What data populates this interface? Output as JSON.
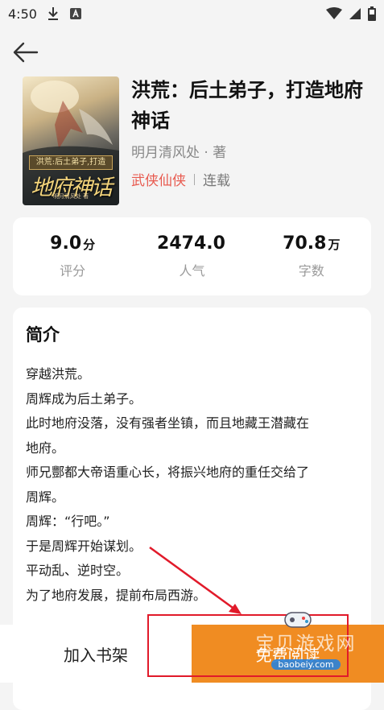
{
  "status_bar": {
    "time": "4:50",
    "left_icons": [
      "download-icon",
      "a-font-icon"
    ],
    "right_icons": [
      "wifi-icon",
      "signal-icon",
      "battery-icon"
    ]
  },
  "header": {
    "back_icon": "back-arrow-icon"
  },
  "book": {
    "title": "洪荒：后土弟子，打造地府神话",
    "author": "明月清风处 · 著",
    "genre": "武侠仙侠",
    "status": "连载",
    "cover": {
      "band_text": "洪荒:后土弟子,打造",
      "big_text": "地府神话",
      "author_text": "明月清风处 著"
    }
  },
  "stats": [
    {
      "value": "9.0",
      "unit": "分",
      "label": "评分"
    },
    {
      "value": "2474.0",
      "unit": "",
      "label": "人气"
    },
    {
      "value": "70.8",
      "unit": "万",
      "label": "字数"
    }
  ],
  "intro": {
    "title": "简介",
    "lines": [
      "穿越洪荒。",
      "周辉成为后土弟子。",
      "此时地府没落，没有强者坐镇，而且地藏王潜藏在",
      "地府。",
      "师兄酆都大帝语重心长，将振兴地府的重任交给了",
      "周辉。",
      "周辉：“行吧。”",
      "于是周辉开始谋划。",
      "平动乱、逆时空。",
      "为了地府发展，提前布局西游。"
    ]
  },
  "bottom": {
    "shelf_label": "加入书架",
    "read_label": "免费阅读"
  },
  "watermark": {
    "title": "宝贝游戏网",
    "url": "baobeiy.com"
  },
  "colors": {
    "accent": "#f08c22",
    "genre": "#e85a4f",
    "annotation": "#e11a2a"
  }
}
